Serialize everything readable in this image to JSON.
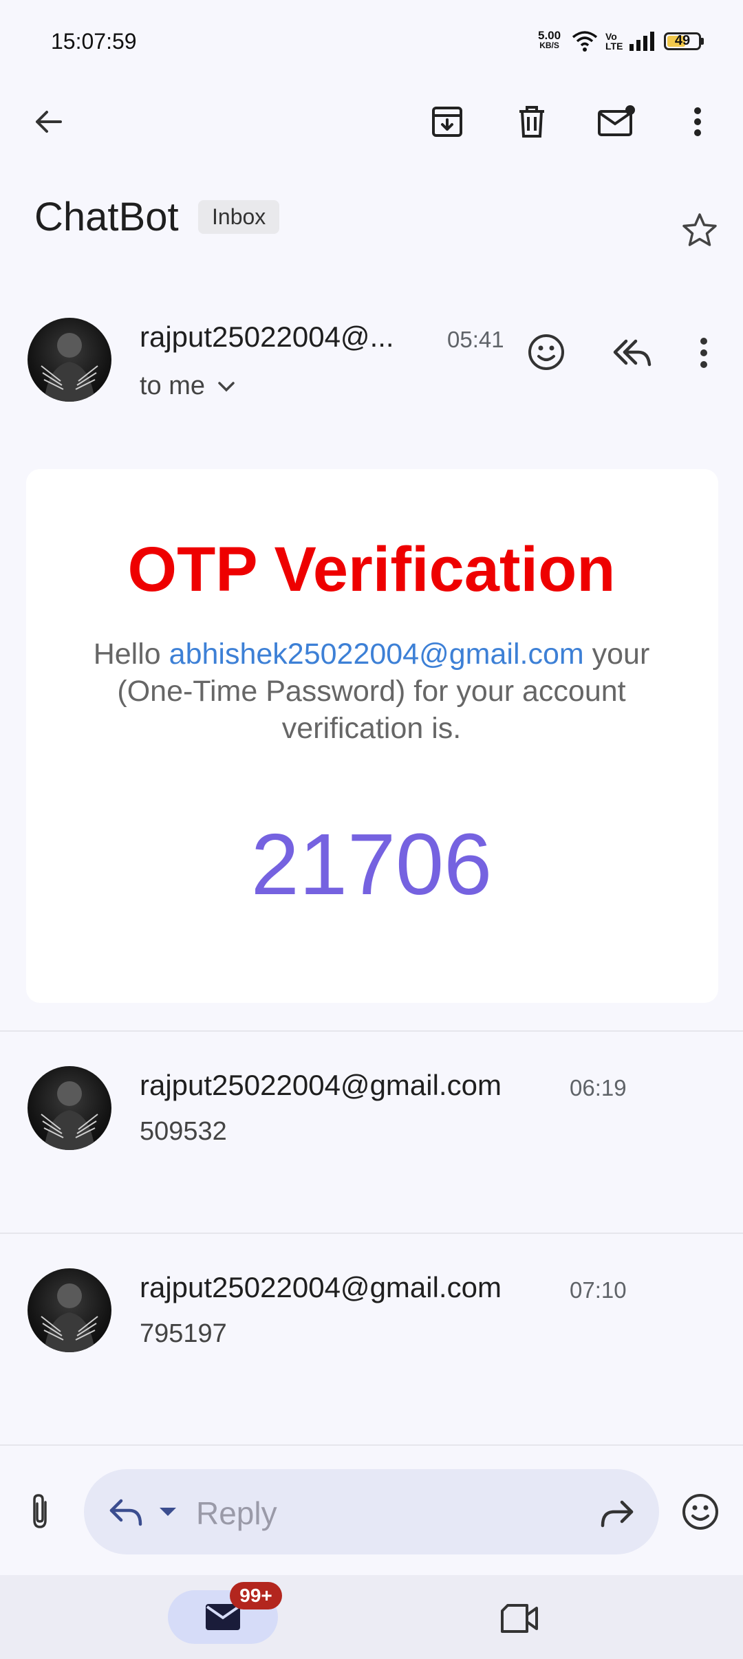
{
  "status_bar": {
    "time": "15:07:59",
    "net_speed_value": "5.00",
    "net_speed_unit": "KB/S",
    "battery": "49"
  },
  "toolbar": {
    "icons": [
      "back-arrow-icon",
      "archive-icon",
      "delete-icon",
      "mark-unread-icon",
      "more-vert-icon"
    ]
  },
  "subject": {
    "title": "ChatBot",
    "label": "Inbox"
  },
  "messages": [
    {
      "sender": "rajput25022004@...",
      "time": "05:41",
      "recipient": "to me"
    },
    {
      "sender": "rajput25022004@gmail.com",
      "time": "06:19",
      "snippet": "509532"
    },
    {
      "sender": "rajput25022004@gmail.com",
      "time": "07:10",
      "snippet": "795197"
    }
  ],
  "email_body": {
    "heading": "OTP Verification",
    "greeting": "Hello",
    "email": "abhishek25022004@gmail.com",
    "text_after_email": "your",
    "text_rest": "(One-Time Password) for your account verification is.",
    "otp": "21706"
  },
  "reply_bar": {
    "placeholder": "Reply"
  },
  "bottom_nav": {
    "mail_badge": "99+"
  },
  "colors": {
    "heading_red": "#ee0000",
    "link_blue": "#3d80d6",
    "otp_purple": "#7562e0",
    "badge_red": "#b3261e"
  }
}
